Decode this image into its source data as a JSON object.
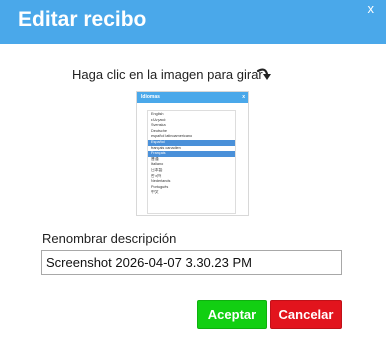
{
  "dialog": {
    "title": "Editar recibo",
    "close_label": "x"
  },
  "rotate": {
    "instruction": "Haga clic en la imagen para girar",
    "icon": "rotate-arrow-icon"
  },
  "preview": {
    "header": "Idiomas",
    "close_label": "x",
    "languages": [
      "English",
      "ελληνικά",
      "Svenska",
      "Deutsche",
      "español latinoamericano",
      "Español",
      "français canadien",
      "Français",
      "普通",
      "Italiano",
      "日本語",
      "한국어",
      "Nederlands",
      "Português",
      "中文"
    ],
    "selected": [
      "Español",
      "Français"
    ]
  },
  "rename": {
    "label": "Renombrar descripción",
    "value": "Screenshot 2026-04-07 3.30.23 PM"
  },
  "buttons": {
    "accept": "Aceptar",
    "cancel": "Cancelar"
  },
  "colors": {
    "title_bar": "#4aa8ea",
    "accept": "#12cf12",
    "cancel": "#e2141d"
  }
}
